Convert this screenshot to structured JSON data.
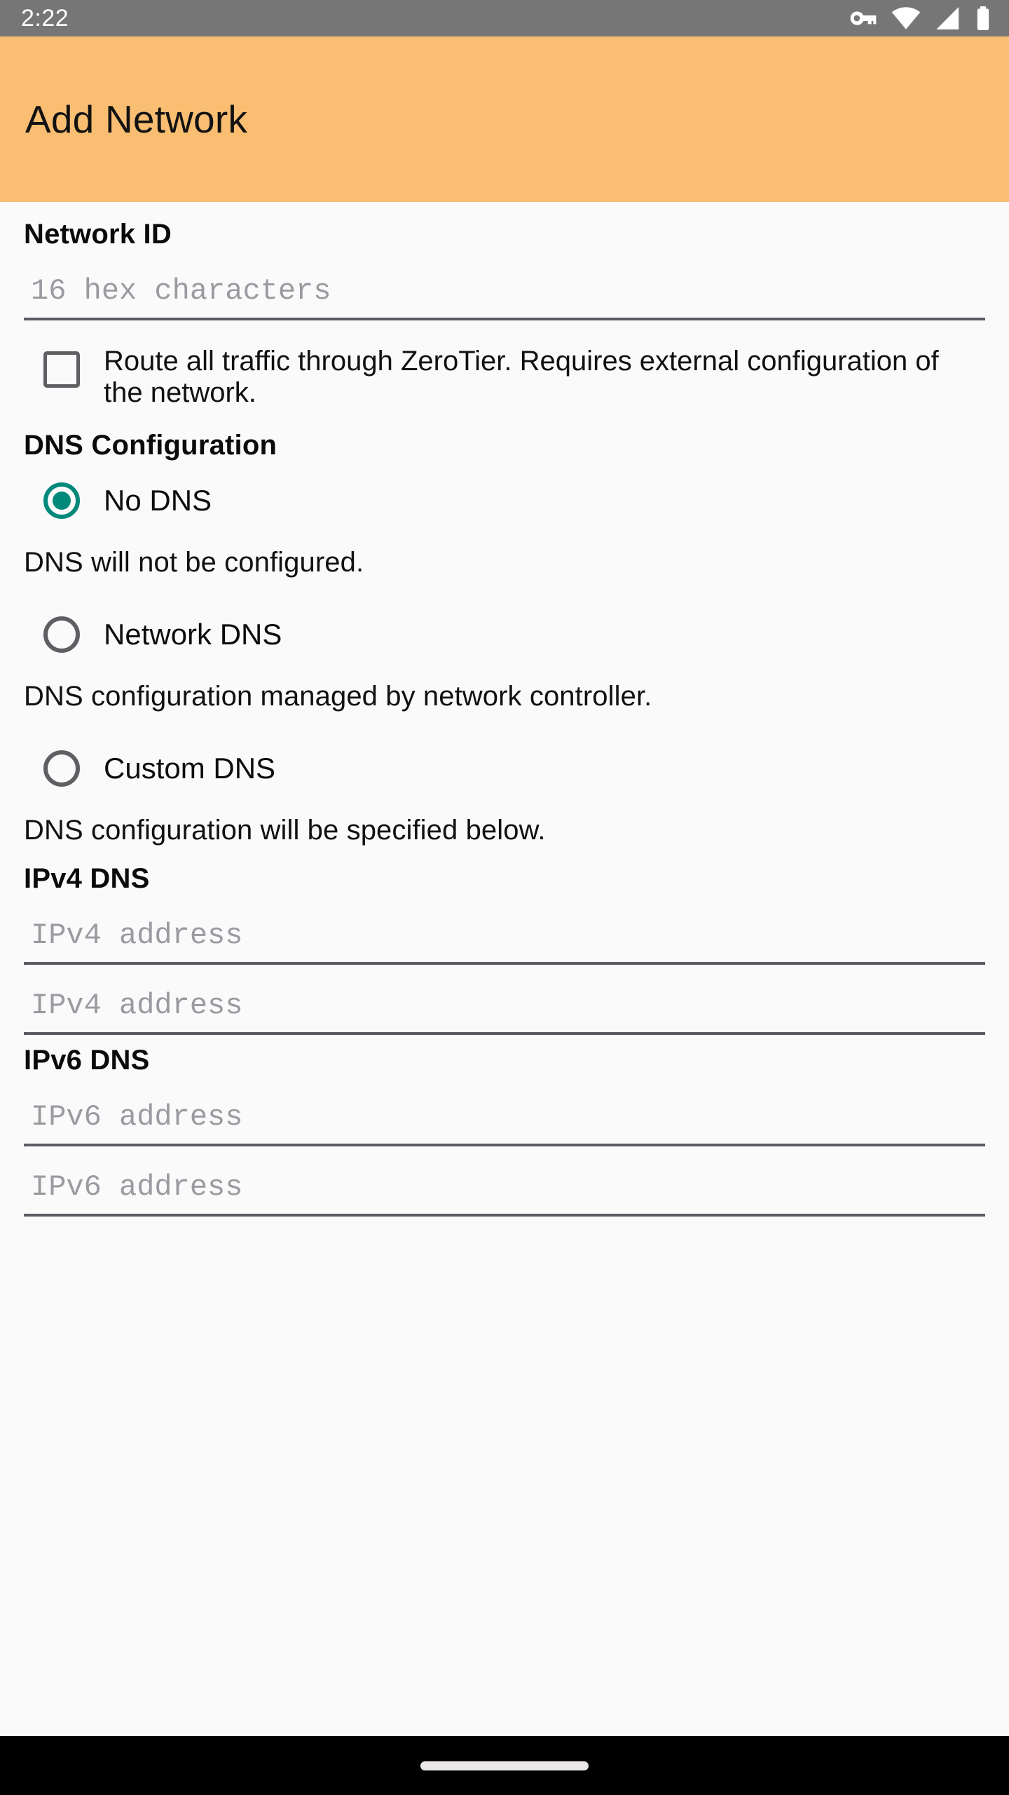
{
  "status_bar": {
    "time": "2:22",
    "icons": [
      "vpn-key-icon",
      "wifi-icon",
      "cell-signal-icon",
      "battery-icon"
    ],
    "background": "#767676",
    "foreground": "#FFFFFF"
  },
  "app_bar": {
    "title": "Add Network",
    "background": "#F9BE72",
    "title_color": "#121212"
  },
  "form": {
    "network_id": {
      "label": "Network ID",
      "placeholder": "16 hex characters",
      "value": ""
    },
    "route_all_traffic": {
      "label": "Route all traffic through ZeroTier. Requires external configuration of the network.",
      "checked": false
    },
    "dns_configuration": {
      "label": "DNS Configuration",
      "selected": "No DNS",
      "options": [
        {
          "label": "No DNS",
          "helper": "DNS will not be configured.",
          "selected": true
        },
        {
          "label": "Network DNS",
          "helper": "DNS configuration managed by network controller.",
          "selected": false
        },
        {
          "label": "Custom DNS",
          "helper": "DNS configuration will be specified below.",
          "selected": false
        }
      ]
    },
    "ipv4_dns": {
      "label": "IPv4 DNS",
      "fields": [
        {
          "placeholder": "IPv4 address",
          "value": ""
        },
        {
          "placeholder": "IPv4 address",
          "value": ""
        }
      ]
    },
    "ipv6_dns": {
      "label": "IPv6 DNS",
      "fields": [
        {
          "placeholder": "IPv6 address",
          "value": ""
        },
        {
          "placeholder": "IPv6 address",
          "value": ""
        }
      ]
    }
  },
  "nav_bar": {
    "gesture_pill": "home-gesture-pill",
    "background": "#000000"
  },
  "colors": {
    "accent_teal": "#00897B",
    "app_bar_orange": "#F9BE72",
    "status_gray": "#767676",
    "page_background": "#FAFAFB",
    "field_underline": "#5B5B61",
    "placeholder": "#9A9AA0"
  }
}
